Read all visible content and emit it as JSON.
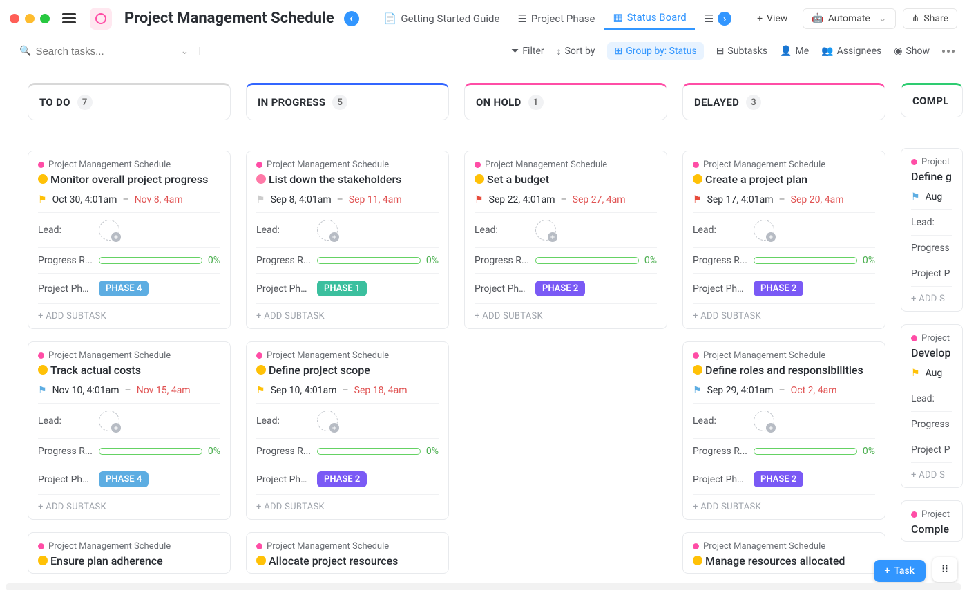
{
  "title": "Project Management Schedule",
  "project_label": "Project Management Schedule",
  "tabs": [
    {
      "label": "Getting Started Guide"
    },
    {
      "label": "Project Phase"
    },
    {
      "label": "Status Board",
      "active": true
    }
  ],
  "top_actions": {
    "view": "View",
    "automate": "Automate",
    "share": "Share"
  },
  "toolbar": {
    "search_placeholder": "Search tasks...",
    "filter": "Filter",
    "sort": "Sort by",
    "group": "Group by: Status",
    "subtasks": "Subtasks",
    "me": "Me",
    "assignees": "Assignees",
    "show": "Show"
  },
  "labels": {
    "lead": "Lead:",
    "progress": "Progress R...",
    "phase": "Project Pha...",
    "add_sub": "+ ADD SUBTASK",
    "add_sub_trunc": "+ ADD S",
    "pct0": "0%"
  },
  "columns": [
    {
      "name": "TO DO",
      "count": "7",
      "color": "#d8d8d8"
    },
    {
      "name": "IN PROGRESS",
      "count": "5",
      "color": "#3366ff"
    },
    {
      "name": "ON HOLD",
      "count": "1",
      "color": "#ff4da6"
    },
    {
      "name": "DELAYED",
      "count": "3",
      "color": "#ff4da6"
    },
    {
      "name": "COMPL",
      "count": "",
      "color": "#2ecc71"
    }
  ],
  "cards": {
    "todo": [
      {
        "title": "Monitor overall project progress",
        "status": "yellow",
        "flag": "🚩",
        "flag_color": "#ffc107",
        "start": "Oct 30, 4:01am",
        "end": "Nov 8, 4am",
        "phase": "PHASE 4",
        "phase_class": "phase-4"
      },
      {
        "title": "Track actual costs",
        "status": "yellow",
        "flag": "🚩",
        "flag_color": "#5dade2",
        "start": "Nov 10, 4:01am",
        "end": "Nov 15, 4am",
        "phase": "PHASE 4",
        "phase_class": "phase-4"
      },
      {
        "title": "Ensure plan adherence",
        "status": "yellow"
      }
    ],
    "inprogress": [
      {
        "title": "List down the stakeholders",
        "status": "pink",
        "flag": "🚩",
        "flag_color": "#ccc",
        "start": "Sep 8, 4:01am",
        "end": "Sep 11, 4am",
        "phase": "PHASE 1",
        "phase_class": "phase-1"
      },
      {
        "title": "Define project scope",
        "status": "yellow",
        "flag": "🚩",
        "flag_color": "#ffc107",
        "start": "Sep 10, 4:01am",
        "end": "Sep 18, 4am",
        "phase": "PHASE 2",
        "phase_class": "phase-2"
      },
      {
        "title": "Allocate project resources",
        "status": "yellow"
      }
    ],
    "onhold": [
      {
        "title": "Set a budget",
        "status": "yellow",
        "flag": "🚩",
        "flag_color": "#e74c3c",
        "start": "Sep 22, 4:01am",
        "end": "Sep 27, 4am",
        "phase": "PHASE 2",
        "phase_class": "phase-2"
      }
    ],
    "delayed": [
      {
        "title": "Create a project plan",
        "status": "yellow",
        "flag": "🚩",
        "flag_color": "#e74c3c",
        "start": "Sep 17, 4:01am",
        "end": "Sep 20, 4am",
        "phase": "PHASE 2",
        "phase_class": "phase-2"
      },
      {
        "title": "Define roles and responsibilities",
        "status": "yellow",
        "flag": "🚩",
        "flag_color": "#5dade2",
        "start": "Sep 29, 4:01am",
        "end": "Oct 2, 4am",
        "phase": "PHASE 2",
        "phase_class": "phase-2"
      },
      {
        "title": "Manage resources allocated",
        "status": "yellow"
      }
    ],
    "completed": [
      {
        "title": "Define g",
        "status": "none",
        "flag": "🚩",
        "flag_color": "#5dade2",
        "start": "Aug",
        "phase_label": "Project P",
        "progress_label": "Progress"
      },
      {
        "title": "Develop",
        "status": "none",
        "flag": "🚩",
        "flag_color": "#ffc107",
        "start": "Aug",
        "phase_label": "Project P",
        "progress_label": "Progress"
      },
      {
        "title": "Comple",
        "status": "none"
      }
    ]
  },
  "completed_trunc": {
    "proj": "Project"
  },
  "float": {
    "task": "Task"
  }
}
